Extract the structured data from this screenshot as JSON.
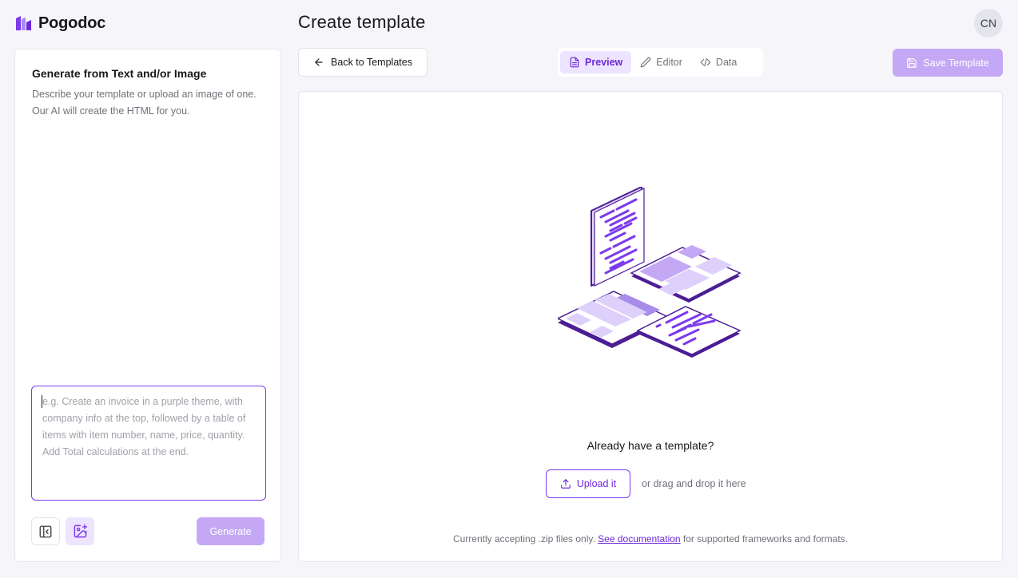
{
  "app": {
    "name": "Pogodoc",
    "logo_icon": "pogodoc-logo"
  },
  "header": {
    "title": "Create template",
    "avatar_initials": "CN"
  },
  "sidebar": {
    "title": "Generate from Text and/or Image",
    "description": "Describe your template or upload an image of one. Our AI will create the HTML for you.",
    "prompt_placeholder": "e.g. Create an invoice in a purple theme, with company info at the top, followed by a table of items with item number, name, price, quantity. Add Total calculations at the end.",
    "prompt_value": "",
    "generate_label": "Generate",
    "tool_icons": [
      "sidebar-collapse-icon",
      "image-add-icon"
    ]
  },
  "toolbar": {
    "back_label": "Back to Templates",
    "tabs": [
      {
        "label": "Preview",
        "icon": "file-text-icon",
        "active": true
      },
      {
        "label": "Editor",
        "icon": "pencil-icon",
        "active": false
      },
      {
        "label": "Data",
        "icon": "code-icon",
        "active": false
      }
    ],
    "save_label": "Save Template"
  },
  "upload": {
    "heading": "Already have a template?",
    "button_label": "Upload it",
    "drag_text": "or drag and drop it here",
    "note_prefix": "Currently accepting .zip files only.",
    "note_link": "See documentation",
    "note_suffix": "for supported frameworks and formats."
  },
  "colors": {
    "accent": "#7c3aed",
    "accent_text": "#6d28d9",
    "accent_soft": "#ede4ff",
    "disabled_button": "#c4a8f5",
    "background": "#f6f6fa"
  }
}
